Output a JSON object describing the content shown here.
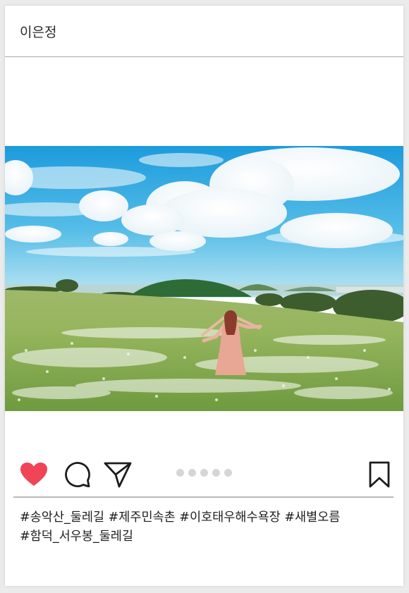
{
  "post": {
    "username": "이은정",
    "photo_alt": "이미지",
    "carousel_count": 5,
    "carousel_active_index": 0,
    "liked": true,
    "hashtags": [
      "#송악산_둘레길 #제주민속촌 #이호태우해수욕장 #새별오름",
      "#함덕_서우봉_둘레길"
    ]
  },
  "colors": {
    "like_red": "#ef4557",
    "icon_dark": "#1c1c1c",
    "dot_inactive": "#d6d6d6"
  },
  "icons": {
    "like": "heart-icon",
    "comment": "comment-icon",
    "share": "share-icon",
    "save": "bookmark-icon"
  }
}
